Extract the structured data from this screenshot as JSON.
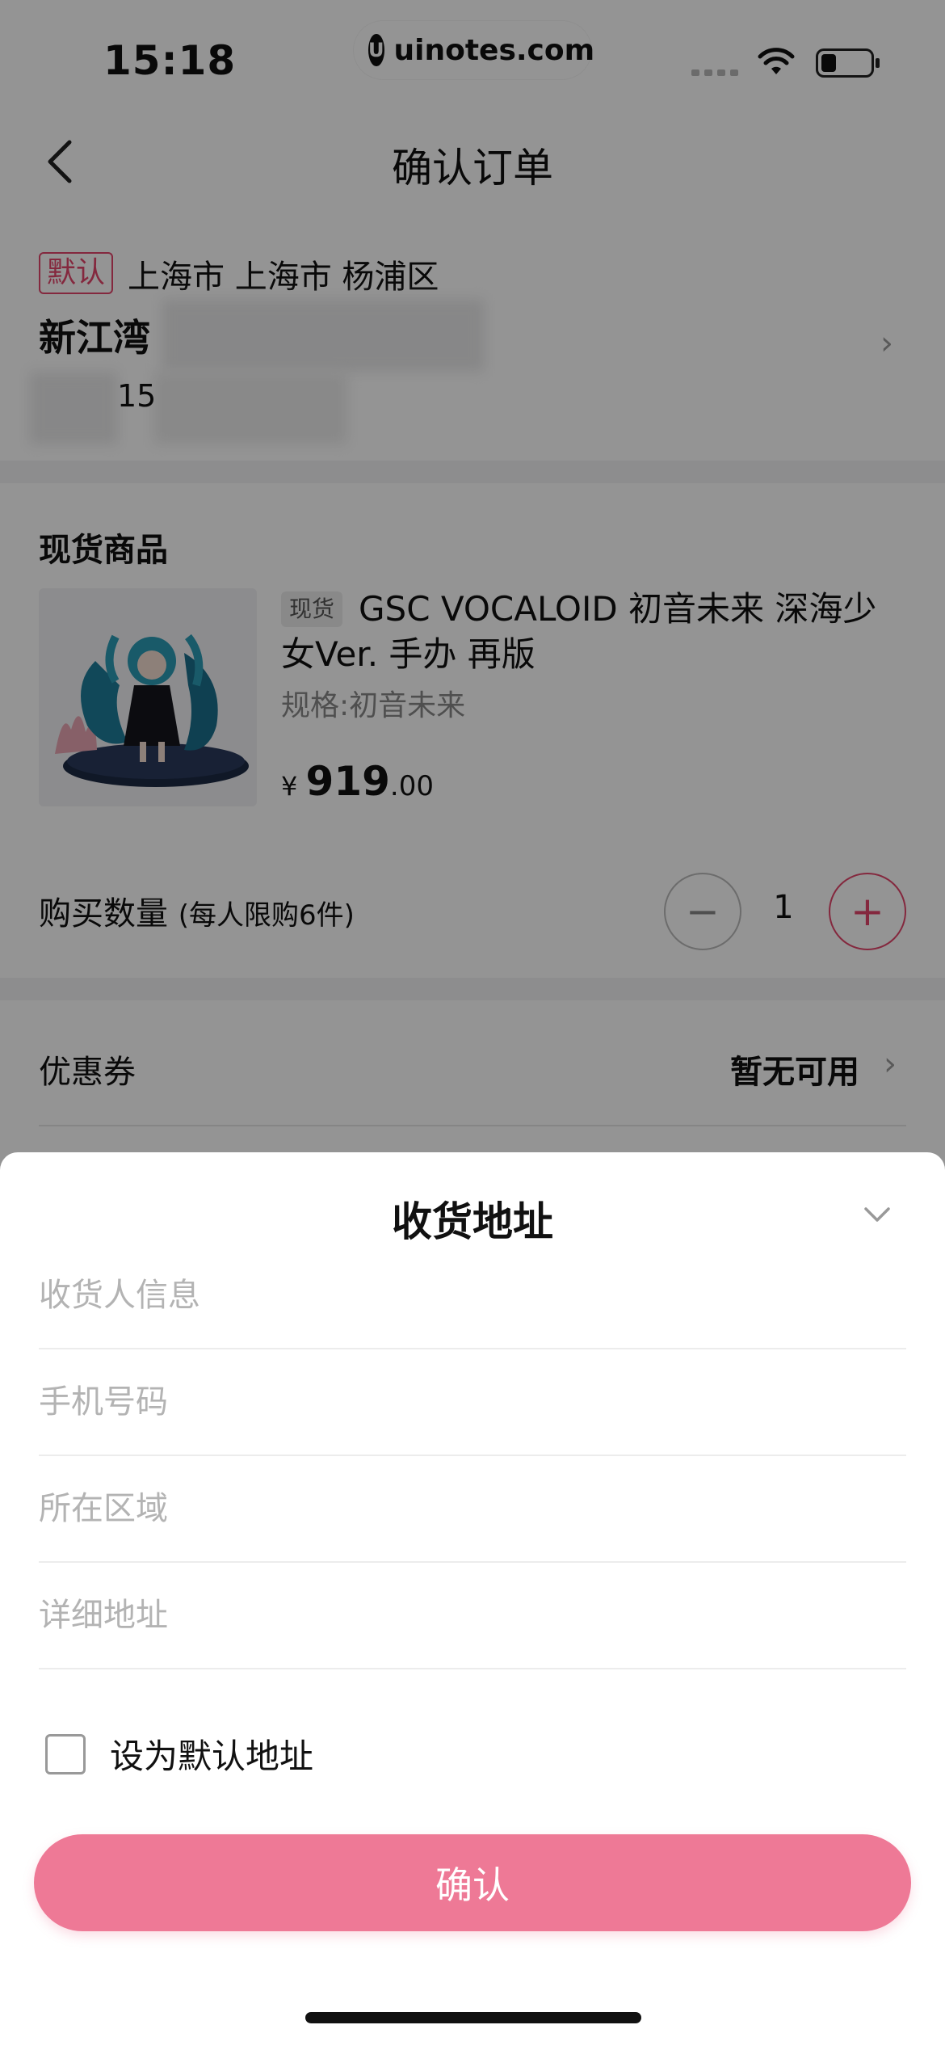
{
  "status_bar": {
    "time": "15:18",
    "pill_logo": "U",
    "pill_text": "uinotes.com",
    "icons": [
      "cellular-signal-icon",
      "wifi-icon",
      "battery-icon"
    ]
  },
  "nav": {
    "back_icon": "chevron-left-icon",
    "title": "确认订单"
  },
  "address": {
    "default_tag": "默认",
    "region": "上海市 上海市 杨浦区",
    "street": "新江湾",
    "phone_partial": "15"
  },
  "product": {
    "section_title": "现货商品",
    "stock_tag": "现货",
    "title": "GSC VOCALOID 初音未来 深海少女Ver. 手办 再版",
    "spec": "规格:初音未来",
    "price_symbol": "¥",
    "price_int": "919",
    "price_dec": ".00",
    "qty_label": "购买数量",
    "qty_limit": "(每人限购6件)",
    "qty_minus": "−",
    "qty_value": "1",
    "qty_plus": "+"
  },
  "coupon": {
    "label": "优惠券",
    "value": "暂无可用"
  },
  "sheet": {
    "title": "收货地址",
    "fields": [
      {
        "placeholder": "收货人信息",
        "value": ""
      },
      {
        "placeholder": "手机号码",
        "value": ""
      },
      {
        "placeholder": "所在区域",
        "value": ""
      },
      {
        "placeholder": "详细地址",
        "value": ""
      }
    ],
    "default_checkbox_label": "设为默认地址",
    "default_checked": false,
    "confirm_label": "确认"
  },
  "colors": {
    "accent": "#e3466b",
    "button": "#ee7996",
    "placeholder": "#b3b3b3"
  }
}
